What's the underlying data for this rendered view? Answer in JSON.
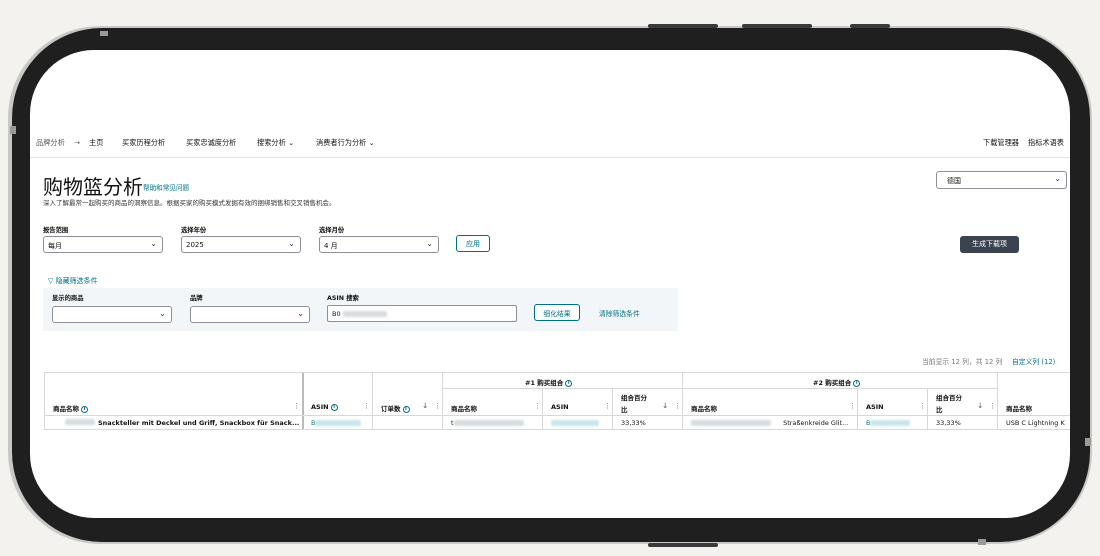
{
  "nav": {
    "breadcrumb": "品牌分析",
    "arrow": "→",
    "home": "主页",
    "items": [
      "买家历程分析",
      "买家忠诚度分析",
      "搜索分析",
      "消费者行为分析"
    ],
    "chevron": "⌄",
    "right_links": [
      "下载管理器",
      "指标术语表"
    ]
  },
  "page": {
    "title": "购物篮分析",
    "help_link": "帮助和常见问题",
    "subtitle": "深入了解最常一起购买的商品的洞察信息。根据买家的购买模式发掘有效的捆绑销售和交叉销售机会。"
  },
  "country_select": {
    "value": "德国"
  },
  "filters": {
    "range_label": "报告范围",
    "range_value": "每月",
    "year_label": "选择年份",
    "year_value": "2025",
    "month_label": "选择月份",
    "month_value": "4 月",
    "apply_label": "应用",
    "generate_label": "生成下载项"
  },
  "sub_filters": {
    "toggle_label": "隐藏筛选条件",
    "products_label": "显示的商品",
    "brand_label": "品牌",
    "asin_label": "ASIN 搜索",
    "asin_value": "B0",
    "refine_label": "细化结果",
    "clear_label": "清除筛选条件"
  },
  "table_info": {
    "columns_shown": "当前显示 12 列，共 12 列",
    "customize_label": "自定义列 (12)"
  },
  "table": {
    "group1": "#1 购买组合",
    "group2": "#2 购买组合",
    "headers": {
      "product_name": "商品名称",
      "asin": "ASIN",
      "orders": "订单数",
      "g_product": "商品名称",
      "g_asin": "ASIN",
      "combo_pct_1": "组合百分",
      "combo_pct_2": "比"
    },
    "row": {
      "product_name": "Snackteller mit Deckel und Griff, Snackbox für Snack...",
      "asin": "B",
      "g1_product": "t",
      "g1_pct": "33,33%",
      "g2_product": "Straßenkreide Glit...",
      "g2_asin": "B",
      "g2_pct": "33,33%",
      "g3_product": "USB C Lightning K"
    }
  },
  "icons": {
    "info": "i",
    "sort_down": "↓",
    "kebab": "⋮",
    "filter_triangle": "▽",
    "select_caret": "⌄"
  }
}
